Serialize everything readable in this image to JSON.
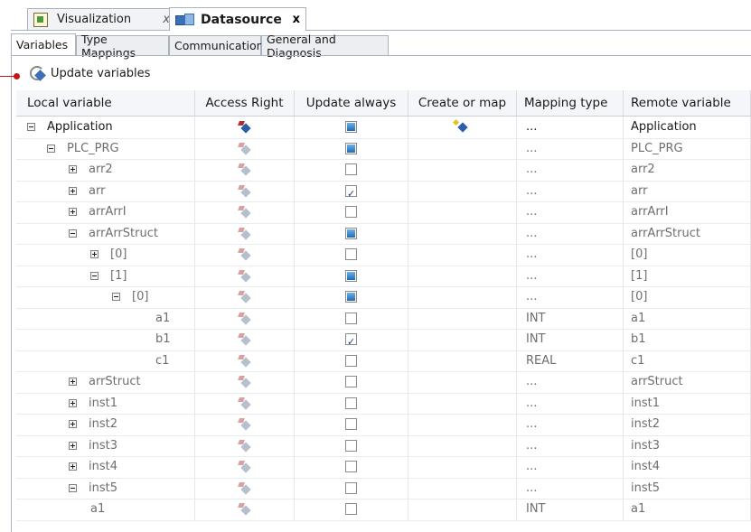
{
  "editor_tabs": [
    {
      "label": "Visualization",
      "icon": "visualization-icon",
      "close": "x"
    },
    {
      "label": "Datasource",
      "icon": "datasource-icon",
      "close": "x"
    }
  ],
  "sub_tabs": [
    "Variables",
    "Type Mappings",
    "Communication",
    "General and Diagnosis"
  ],
  "toolbar": {
    "update_label": "Update variables",
    "icon": "update-icon"
  },
  "table": {
    "headers": [
      "Local variable",
      "Access Right",
      "Update always",
      "Create or map",
      "Mapping type",
      "Remote variable"
    ],
    "rows": [
      {
        "name": "Application",
        "toggle": "minus",
        "indent": 0,
        "dim": false,
        "access": "strong",
        "update": "partial",
        "create": true,
        "mapping": "...",
        "remote": "Application"
      },
      {
        "name": "PLC_PRG",
        "toggle": "minus",
        "indent": 1,
        "dim": true,
        "access": "light",
        "update": "partial",
        "create": false,
        "mapping": "...",
        "remote": "PLC_PRG"
      },
      {
        "name": "arr2",
        "toggle": "plus",
        "indent": 2,
        "dim": true,
        "access": "light",
        "update": "empty",
        "create": false,
        "mapping": "...",
        "remote": "arr2"
      },
      {
        "name": "arr",
        "toggle": "plus",
        "indent": 2,
        "dim": true,
        "access": "light",
        "update": "checked",
        "create": false,
        "mapping": "...",
        "remote": "arr"
      },
      {
        "name": "arrArrI",
        "toggle": "plus",
        "indent": 2,
        "dim": true,
        "access": "light",
        "update": "empty",
        "create": false,
        "mapping": "...",
        "remote": "arrArrI"
      },
      {
        "name": "arrArrStruct",
        "toggle": "minus",
        "indent": 2,
        "dim": true,
        "access": "light",
        "update": "partial",
        "create": false,
        "mapping": "...",
        "remote": "arrArrStruct"
      },
      {
        "name": "[0]",
        "toggle": "plus",
        "indent": 3,
        "dim": true,
        "access": "light",
        "update": "empty",
        "create": false,
        "mapping": "...",
        "remote": "[0]"
      },
      {
        "name": "[1]",
        "toggle": "minus",
        "indent": 3,
        "dim": true,
        "access": "light",
        "update": "partial",
        "create": false,
        "mapping": "...",
        "remote": "[1]"
      },
      {
        "name": "[0]",
        "toggle": "minus",
        "indent": 4,
        "dim": true,
        "access": "light",
        "update": "partial",
        "create": false,
        "mapping": "...",
        "remote": "[0]"
      },
      {
        "name": "a1",
        "toggle": "none",
        "indent": 6,
        "dim": true,
        "access": "light",
        "update": "empty",
        "create": false,
        "mapping": "INT",
        "remote": "a1"
      },
      {
        "name": "b1",
        "toggle": "none",
        "indent": 6,
        "dim": true,
        "access": "light",
        "update": "checked",
        "create": false,
        "mapping": "INT",
        "remote": "b1"
      },
      {
        "name": "c1",
        "toggle": "none",
        "indent": 6,
        "dim": true,
        "access": "light",
        "update": "empty",
        "create": false,
        "mapping": "REAL",
        "remote": "c1"
      },
      {
        "name": "arrStruct",
        "toggle": "plus",
        "indent": 2,
        "dim": true,
        "access": "light",
        "update": "empty",
        "create": false,
        "mapping": "...",
        "remote": "arrStruct"
      },
      {
        "name": "inst1",
        "toggle": "plus",
        "indent": 2,
        "dim": true,
        "access": "light",
        "update": "empty",
        "create": false,
        "mapping": "...",
        "remote": "inst1"
      },
      {
        "name": "inst2",
        "toggle": "plus",
        "indent": 2,
        "dim": true,
        "access": "light",
        "update": "empty",
        "create": false,
        "mapping": "...",
        "remote": "inst2"
      },
      {
        "name": "inst3",
        "toggle": "plus",
        "indent": 2,
        "dim": true,
        "access": "light",
        "update": "empty",
        "create": false,
        "mapping": "...",
        "remote": "inst3"
      },
      {
        "name": "inst4",
        "toggle": "plus",
        "indent": 2,
        "dim": true,
        "access": "light",
        "update": "empty",
        "create": false,
        "mapping": "...",
        "remote": "inst4"
      },
      {
        "name": "inst5",
        "toggle": "minus",
        "indent": 2,
        "dim": true,
        "access": "light",
        "update": "empty",
        "create": false,
        "mapping": "...",
        "remote": "inst5"
      },
      {
        "name": "a1",
        "toggle": "none",
        "indent": 3,
        "dim": true,
        "access": "light",
        "update": "empty",
        "create": false,
        "mapping": "INT",
        "remote": "a1"
      }
    ]
  },
  "colors": {
    "callout": "#c2151b",
    "checkbox_fill": "#1f6bb5"
  }
}
